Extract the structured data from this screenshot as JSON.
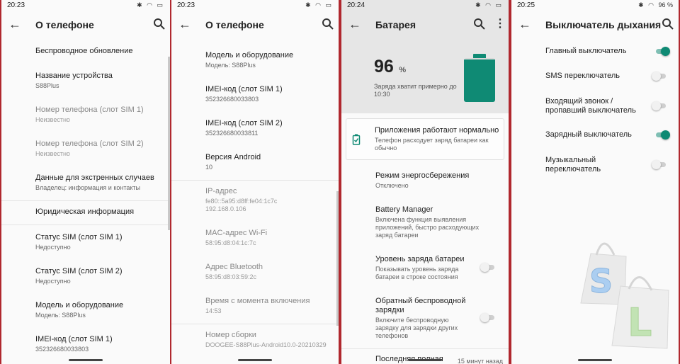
{
  "accent": "#0f8a74",
  "frame_color": "#b0282f",
  "panels": [
    {
      "time": "20:23",
      "title": "О телефоне",
      "items": [
        {
          "title": "Беспроводное обновление",
          "sub": ""
        },
        {
          "title": "Название устройства",
          "sub": "S88Plus"
        },
        {
          "title": "Номер телефона (слот SIM 1)",
          "sub": "Неизвестно"
        },
        {
          "title": "Номер телефона (слот SIM 2)",
          "sub": "Неизвестно"
        },
        {
          "title": "Данные для экстренных случаев",
          "sub": "Владелец: информация и контакты"
        },
        {
          "title": "Юридическая информация",
          "sub": ""
        },
        {
          "title": "Статус SIM (слот SIM 1)",
          "sub": "Недоступно"
        },
        {
          "title": "Статус SIM (слот SIM 2)",
          "sub": "Недоступно"
        },
        {
          "title": "Модель и оборудование",
          "sub": "Модель: S88Plus"
        },
        {
          "title": "IMEI-код (слот SIM 1)",
          "sub": "352326680033803"
        }
      ]
    },
    {
      "time": "20:23",
      "title": "О телефоне",
      "items": [
        {
          "title": "Модель и оборудование",
          "sub": "Модель: S88Plus"
        },
        {
          "title": "IMEI-код (слот SIM 1)",
          "sub": "352326680033803"
        },
        {
          "title": "IMEI-код (слот SIM 2)",
          "sub": "352326680033811"
        },
        {
          "title": "Версия Android",
          "sub": "10"
        },
        {
          "title": "IP-адрес",
          "sub": "fe80::5a95:d8ff:fe04:1c7c",
          "sub2": "192.168.0.106"
        },
        {
          "title": "MAC-адрес Wi-Fi",
          "sub": "58:95:d8:04:1c:7c"
        },
        {
          "title": "Адрес Bluetooth",
          "sub": "58:95:d8:03:59:2c"
        },
        {
          "title": "Время с момента включения",
          "sub": "14:53"
        },
        {
          "title": "Номер сборки",
          "sub": "DOOGEE-S88Plus-Android10.0-20210329"
        }
      ]
    },
    {
      "time": "20:24",
      "title": "Батарея",
      "battery_level": "96",
      "battery_unit": "%",
      "battery_fraction": 0.96,
      "remaining": "Заряда хватит примерно до 10:30",
      "status_card": {
        "title": "Приложения работают нормально",
        "sub": "Телефон расходует заряд батареи как обычно"
      },
      "items": [
        {
          "title": "Режим энергосбережения",
          "sub": "Отключено"
        },
        {
          "title": "Battery Manager",
          "sub": "Включена функция выявления приложений, быстро расходующих заряд батареи"
        },
        {
          "title": "Уровень заряда батареи",
          "sub": "Показывать уровень заряда батареи в строке состояния"
        },
        {
          "title": "Обратный беспроводной зарядки",
          "sub": "Включите беспроводную зарядку для зарядки других телефонов"
        },
        {
          "title": "Последняя полная",
          "sub": "",
          "right": "15 минут назад"
        }
      ]
    },
    {
      "time": "20:25",
      "battery_status": "96 %",
      "title": "Выключатель дыхания",
      "items": [
        {
          "title": "Главный выключатель",
          "on": true
        },
        {
          "title": "SMS переключатель",
          "on": false
        },
        {
          "title": "Входящий звонок / пропавший выключатель",
          "on": false
        },
        {
          "title": "Зарядный выключатель",
          "on": true
        },
        {
          "title": "Музыкальный переключатель",
          "on": false
        }
      ]
    }
  ],
  "watermark": {
    "letters": [
      "S",
      "L"
    ]
  }
}
